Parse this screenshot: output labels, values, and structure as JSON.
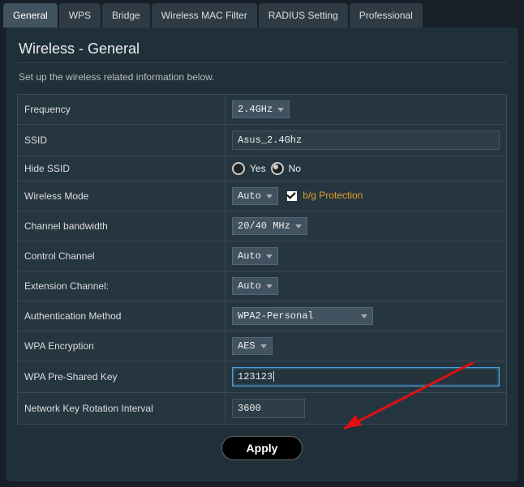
{
  "tabs": {
    "general": "General",
    "wps": "WPS",
    "bridge": "Bridge",
    "macfilter": "Wireless MAC Filter",
    "radius": "RADIUS Setting",
    "professional": "Professional"
  },
  "title": "Wireless - General",
  "description": "Set up the wireless related information below.",
  "labels": {
    "frequency": "Frequency",
    "ssid": "SSID",
    "hide_ssid": "Hide SSID",
    "wireless_mode": "Wireless Mode",
    "channel_bw": "Channel bandwidth",
    "control_channel": "Control Channel",
    "extension_channel": "Extension Channel:",
    "auth_method": "Authentication Method",
    "wpa_encryption": "WPA Encryption",
    "wpa_psk": "WPA Pre-Shared Key",
    "key_rotation": "Network Key Rotation Interval"
  },
  "values": {
    "frequency": "2.4GHz",
    "ssid": "Asus_2.4Ghz",
    "hide_ssid_yes": "Yes",
    "hide_ssid_no": "No",
    "wireless_mode": "Auto",
    "bg_protection": "b/g Protection",
    "channel_bw": "20/40 MHz",
    "control_channel": "Auto",
    "extension_channel": "Auto",
    "auth_method": "WPA2-Personal",
    "wpa_encryption": "AES",
    "wpa_psk": "123123",
    "key_rotation": "3600"
  },
  "apply": "Apply"
}
